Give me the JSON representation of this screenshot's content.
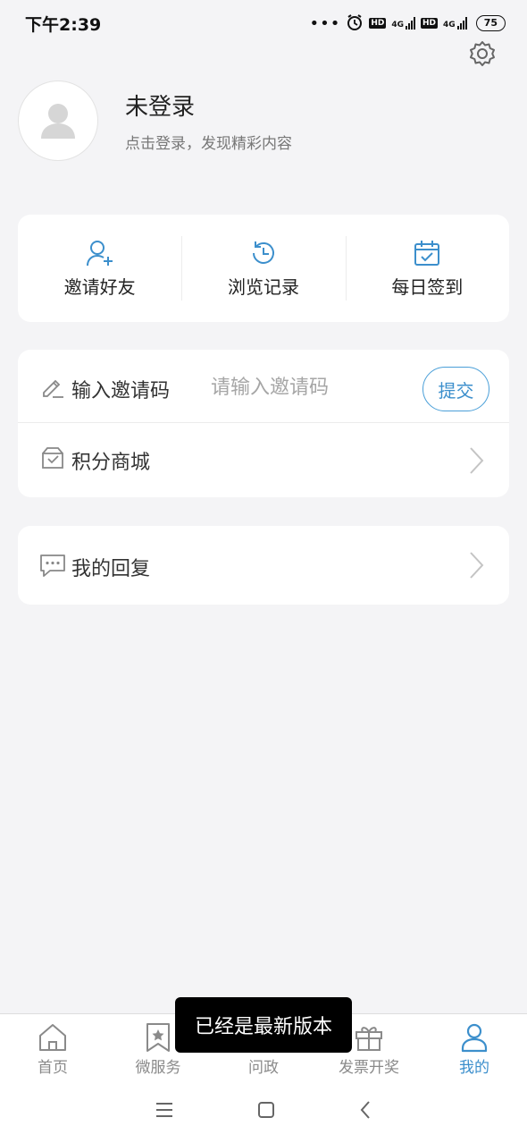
{
  "status": {
    "time": "下午2:39",
    "dots": "•••",
    "hd1": "HD",
    "net1": "4G",
    "hd2": "HD",
    "net2": "4G",
    "battery": "75"
  },
  "profile": {
    "name": "未登录",
    "subtitle": "点击登录，发现精彩内容"
  },
  "quick_actions": [
    {
      "label": "邀请好友",
      "icon": "invite-user-icon"
    },
    {
      "label": "浏览记录",
      "icon": "history-icon"
    },
    {
      "label": "每日签到",
      "icon": "calendar-check-icon"
    }
  ],
  "invite": {
    "label": "输入邀请码",
    "placeholder": "请输入邀请码",
    "submit": "提交"
  },
  "mall": {
    "label": "积分商城"
  },
  "reply": {
    "label": "我的回复"
  },
  "tabs": [
    {
      "label": "首页",
      "icon": "home-icon"
    },
    {
      "label": "微服务",
      "icon": "bookmark-star-icon"
    },
    {
      "label": "问政",
      "icon": "chat-icon"
    },
    {
      "label": "发票开奖",
      "icon": "gift-icon"
    },
    {
      "label": "我的",
      "icon": "user-icon"
    }
  ],
  "toast": "已经是最新版本",
  "colors": {
    "accent": "#3c8fcc",
    "background": "#f4f4f6",
    "card": "#ffffff"
  }
}
